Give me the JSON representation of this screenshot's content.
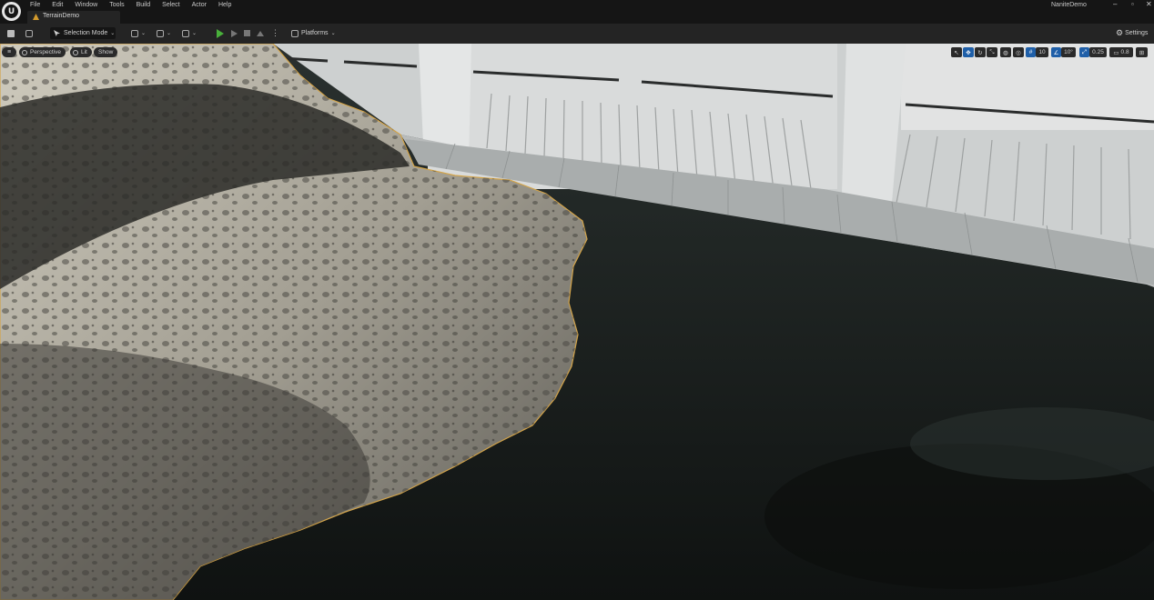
{
  "menu": [
    "File",
    "Edit",
    "Window",
    "Tools",
    "Build",
    "Select",
    "Actor",
    "Help"
  ],
  "document_tab": "TerrainDemo",
  "project_name": "NaniteDemo",
  "window_controls": {
    "minimize": "–",
    "maximize": "▫",
    "close": "✕"
  },
  "toolbar": {
    "selection_mode": "Selection Mode",
    "platforms": "Platforms",
    "settings": "Settings"
  },
  "viewport": {
    "perspective": "Perspective",
    "lit": "Lit",
    "show": "Show",
    "grid_snap": "10",
    "rotation_snap": "10°",
    "scale_snap": "0.25",
    "camera_speed": "0.8"
  },
  "colors": {
    "accent_play": "#49b03b",
    "selection_outline": "#d3a44a",
    "highlight_blue": "#1f5fa8"
  }
}
